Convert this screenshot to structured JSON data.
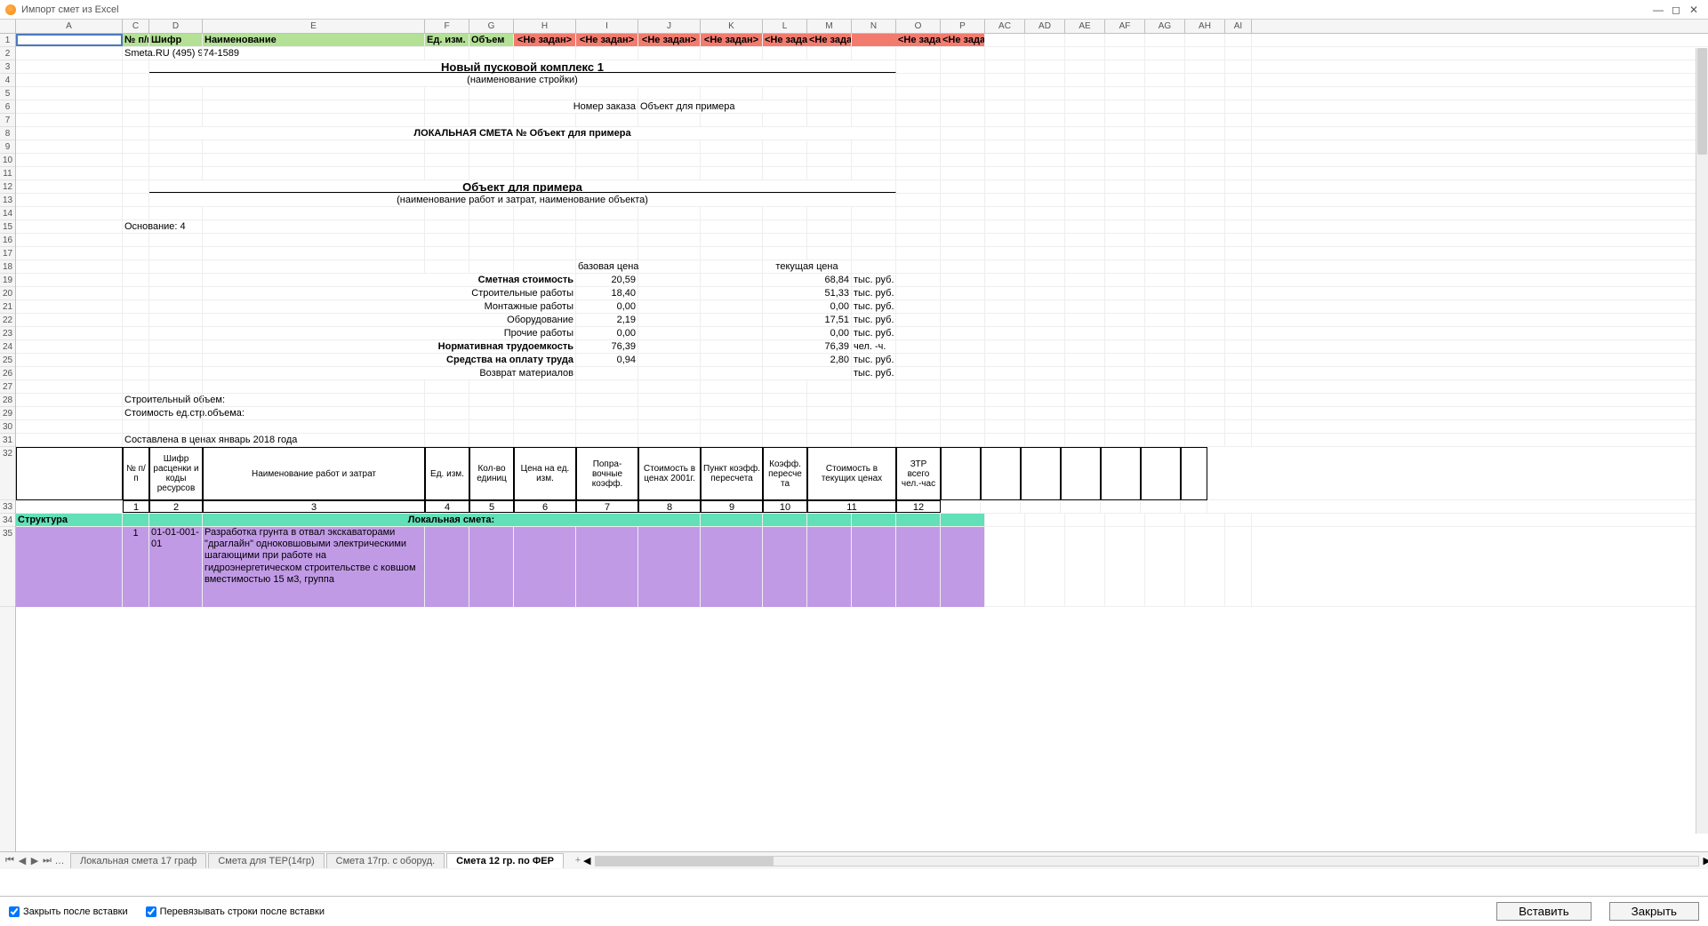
{
  "window": {
    "title": "Импорт смет из Excel"
  },
  "columns": {
    "A": 120,
    "C": 30,
    "D": 60,
    "E": 250,
    "F": 50,
    "G": 50,
    "H": 70,
    "I": 70,
    "J": 70,
    "K": 70,
    "L": 50,
    "M": 50,
    "N": 50,
    "O": 50,
    "P": 50,
    "AC": 45,
    "AD": 45,
    "AE": 45,
    "AF": 45,
    "AG": 45,
    "AH": 45,
    "AI": 30
  },
  "col_labels": [
    "A",
    "C",
    "D",
    "E",
    "F",
    "G",
    "H",
    "I",
    "J",
    "K",
    "L",
    "M",
    "N",
    "O",
    "P",
    "AC",
    "AD",
    "AE",
    "AF",
    "AG",
    "AH",
    "AI"
  ],
  "header_row": {
    "C": "№ п/п",
    "D": "Шифр",
    "E": "Наименование",
    "F": "Ед. изм.",
    "G": "Объем",
    "H": "<Не задан>",
    "I": "<Не задан>",
    "J": "<Не задан>",
    "K": "<Не задан>",
    "L": "",
    "M": "<Не задан>",
    "MM": "<Не задан>",
    "N": "",
    "O": "<Не задан>",
    "OO": "<Не задан>",
    "P": "<Не задан>"
  },
  "row2": {
    "text": "Smeta.RU  (495) 974-1589"
  },
  "row3": {
    "title": "Новый пусковой комплекс 1"
  },
  "row4": {
    "sub": "(наименование стройки)"
  },
  "row6": {
    "a": "Номер заказа",
    "b": "Объект для примера"
  },
  "row8": {
    "text": "ЛОКАЛЬНАЯ СМЕТА № Объект для примера"
  },
  "row12": {
    "text": "Объект для примера"
  },
  "row13": {
    "text": "(наименование работ и затрат, наименование объекта)"
  },
  "row15": {
    "text": "Основание: 4"
  },
  "row18": {
    "a": "базовая цена",
    "b": "текущая цена"
  },
  "summary": [
    {
      "label": "Сметная стоимость",
      "v1": "20,59",
      "v2": "68,84",
      "unit": "тыс. руб.",
      "bold": true
    },
    {
      "label": "Строительные работы",
      "v1": "18,40",
      "v2": "51,33",
      "unit": "тыс. руб."
    },
    {
      "label": "Монтажные работы",
      "v1": "0,00",
      "v2": "0,00",
      "unit": "тыс. руб."
    },
    {
      "label": "Оборудование",
      "v1": "2,19",
      "v2": "17,51",
      "unit": "тыс. руб."
    },
    {
      "label": "Прочие работы",
      "v1": "0,00",
      "v2": "0,00",
      "unit": "тыс. руб."
    },
    {
      "label": "Нормативная трудоемкость",
      "v1": "76,39",
      "v2": "76,39",
      "unit": "чел. -ч.",
      "bold": true
    },
    {
      "label": "Средства на оплату труда",
      "v1": "0,94",
      "v2": "2,80",
      "unit": "тыс. руб.",
      "bold": true
    },
    {
      "label": "Возврат материалов",
      "v1": "",
      "v2": "",
      "unit": "тыс. руб."
    }
  ],
  "row28": {
    "text": "Строительный объем:"
  },
  "row29": {
    "text": "Стоимость ед.стр.объема:"
  },
  "row31": {
    "text": "Составлена в ценах январь 2018 года"
  },
  "table_head": [
    "№ п/п",
    "Шифр расценки и коды ресурсов",
    "Наименование работ и затрат",
    "Ед. изм.",
    "Кол-во единиц",
    "Цена на ед. изм.",
    "Попра-вочные коэфф.",
    "Стоимость в ценах 2001г.",
    "Пункт коэфф. пересчета",
    "Коэфф. пересче та",
    "Стоимость в текущих ценах",
    "ЗТР всего чел.-час"
  ],
  "table_nums": [
    "1",
    "2",
    "3",
    "4",
    "5",
    "6",
    "7",
    "8",
    "9",
    "10",
    "11",
    "12"
  ],
  "row34": {
    "a": "Структура",
    "b": "Локальная смета:"
  },
  "item1": {
    "num": "1",
    "code": "01-01-001-01",
    "name": "Разработка грунта в отвал экскаваторами \"драглайн\" одноковшовыми электрическими шагающими при работе на гидроэнергетическом строительстве с ковшом вместимостью 15 м3, группа"
  },
  "sheets": {
    "items": [
      "Локальная смета 17 граф",
      "Смета для ТЕР(14гр)",
      "Смета 17гр. с оборуд.",
      "Смета 12 гр. по ФЕР"
    ],
    "active": 3
  },
  "footer": {
    "close_after": "Закрыть после вставки",
    "rebind_rows": "Перевязывать строки после вставки",
    "insert": "Вставить",
    "close": "Закрыть"
  }
}
